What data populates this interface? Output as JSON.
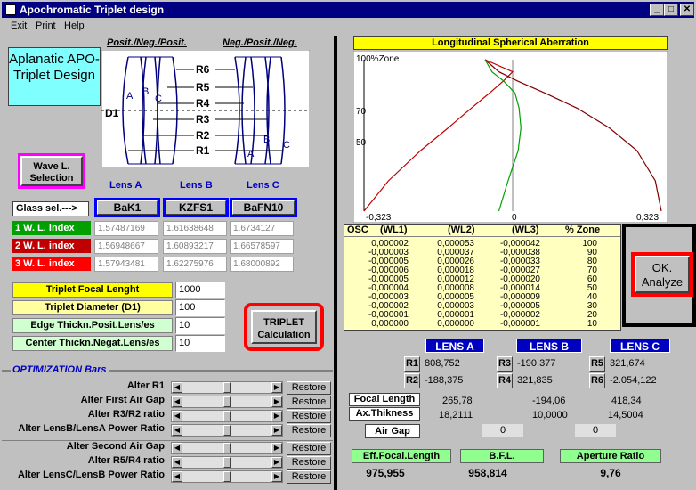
{
  "window": {
    "title": "Apochromatic Triplet design",
    "minimize": "_",
    "maximize": "□",
    "close": "✕"
  },
  "menu": [
    "Exit",
    "Print",
    "Help"
  ],
  "schematic": {
    "title_left": "Posit./Neg./Posit.",
    "title_right": "Neg./Posit./Neg.",
    "radii": [
      "R6",
      "R5",
      "R4",
      "R3",
      "R2",
      "R1"
    ],
    "d1": "D1",
    "left_letters": [
      "A",
      "B",
      "C"
    ],
    "right_letters": [
      "A",
      "B",
      "C"
    ]
  },
  "app_label": "Aplanatic APO-Triplet Design",
  "wavel_button": "Wave L. Selection",
  "lens_headers": [
    "Lens A",
    "Lens B",
    "Lens C"
  ],
  "glass_sel_label": "Glass sel.--->",
  "glass": [
    "BaK1",
    "KZFS1",
    "BaFN10"
  ],
  "wl_rows": [
    {
      "label": "1 W. L. index",
      "color": "#00a000",
      "values": [
        "1.57487169",
        "1.61638648",
        "1.6734127"
      ]
    },
    {
      "label": "2 W. L. index",
      "color": "#c00000",
      "values": [
        "1.56948667",
        "1.60893217",
        "1.66578597"
      ]
    },
    {
      "label": "3 W. L. index",
      "color": "#ff0000",
      "values": [
        "1.57943481",
        "1.62275976",
        "1.68000892"
      ]
    }
  ],
  "params": [
    {
      "label": "Triplet Focal Lenght",
      "value": "1000",
      "bg": "#ffff00"
    },
    {
      "label": "Triplet Diameter  (D1)",
      "value": "100",
      "bg": "#ffffa0"
    },
    {
      "label": "Edge Thickn.Posit.Lens/es",
      "value": "10",
      "bg": "#d0ffd0"
    },
    {
      "label": "Center Thickn.Negat.Lens/es",
      "value": "10",
      "bg": "#d0ffd0"
    }
  ],
  "triplet_calc": "TRIPLET Calculation",
  "opt_title": "OPTIMIZATION Bars",
  "opt_rows": [
    {
      "label": "Alter  R1",
      "pos": 0.5
    },
    {
      "label": "Alter  First Air Gap",
      "pos": 0.5
    },
    {
      "label": "Alter R3/R2  ratio",
      "pos": 0.5
    },
    {
      "label": "Alter LensB/LensA Power Ratio",
      "pos": 0.5
    },
    {
      "label": "Alter Second Air Gap",
      "pos": 0.5
    },
    {
      "label": "Alter R5/R4 ratio",
      "pos": 0.5
    },
    {
      "label": "Alter LensC/LensB Power Ratio",
      "pos": 0.5
    }
  ],
  "restore": "Restore",
  "chart_data": {
    "type": "line",
    "title": "Longitudinal Spherical Aberration",
    "ylabel": "100%Zone",
    "y_ticks": [
      "70",
      "50"
    ],
    "x_ticks": [
      "-0,323",
      "0",
      "0,323"
    ],
    "xlim": [
      -0.323,
      0.323
    ],
    "ylim": [
      0,
      100
    ],
    "series": [
      {
        "color": "#c00000",
        "x": [
          -0.323,
          -0.27,
          -0.2,
          -0.14,
          -0.09,
          -0.05,
          -0.02,
          0.0,
          -0.06
        ],
        "y": [
          0,
          20,
          40,
          55,
          68,
          78,
          86,
          92,
          100
        ]
      },
      {
        "color": "#800000",
        "x": [
          0.323,
          0.31,
          0.27,
          0.21,
          0.14,
          0.07,
          0.01,
          -0.03,
          -0.06
        ],
        "y": [
          0,
          20,
          40,
          55,
          68,
          78,
          86,
          92,
          100
        ]
      },
      {
        "color": "#00a000",
        "x": [
          -0.03,
          -0.01,
          0.012,
          0.018,
          0.014,
          0.005,
          -0.02,
          -0.045,
          -0.06
        ],
        "y": [
          0,
          20,
          40,
          55,
          68,
          78,
          86,
          92,
          100
        ]
      }
    ]
  },
  "osc": {
    "headers": [
      "OSC",
      "(WL1)",
      "(WL2)",
      "(WL3)",
      "% Zone"
    ],
    "rows": [
      [
        "0,000002",
        "0,000053",
        "-0,000042",
        "100"
      ],
      [
        "-0,000003",
        "0,000037",
        "-0,000038",
        "90"
      ],
      [
        "-0,000005",
        "0,000026",
        "-0,000033",
        "80"
      ],
      [
        "-0,000006",
        "0,000018",
        "-0,000027",
        "70"
      ],
      [
        "-0,000005",
        "0,000012",
        "-0,000020",
        "60"
      ],
      [
        "-0,000004",
        "0,000008",
        "-0,000014",
        "50"
      ],
      [
        "-0,000003",
        "0,000005",
        "-0,000009",
        "40"
      ],
      [
        "-0,000002",
        "0,000003",
        "-0,000005",
        "30"
      ],
      [
        "-0,000001",
        "0,000001",
        "-0,000002",
        "20"
      ],
      [
        "0,000000",
        "0,000000",
        "-0,000001",
        "10"
      ]
    ]
  },
  "analyze_button": "OK. Analyze",
  "lens_summary": {
    "headers": [
      "LENS A",
      "LENS B",
      "LENS C"
    ],
    "radii": [
      {
        "label": "R1",
        "value": "808,752"
      },
      {
        "label": "R2",
        "value": "-188,375"
      },
      {
        "label": "R3",
        "value": "-190,377"
      },
      {
        "label": "R4",
        "value": "321,835"
      },
      {
        "label": "R5",
        "value": "321,674"
      },
      {
        "label": "R6",
        "value": "-2.054,122"
      }
    ],
    "focal_label": "Focal Length",
    "focal_values": [
      "265,78",
      "-194,06",
      "418,34"
    ],
    "thick_label": "Ax.Thikness",
    "thick_values": [
      "18,2111",
      "10,0000",
      "14,5004"
    ],
    "air_label": "Air Gap",
    "air_values": [
      "0",
      "0"
    ]
  },
  "results": [
    {
      "label": "Eff.Focal.Length",
      "value": "975,955"
    },
    {
      "label": "B.F.L.",
      "value": "958,814"
    },
    {
      "label": "Aperture Ratio",
      "value": "9,76"
    }
  ]
}
